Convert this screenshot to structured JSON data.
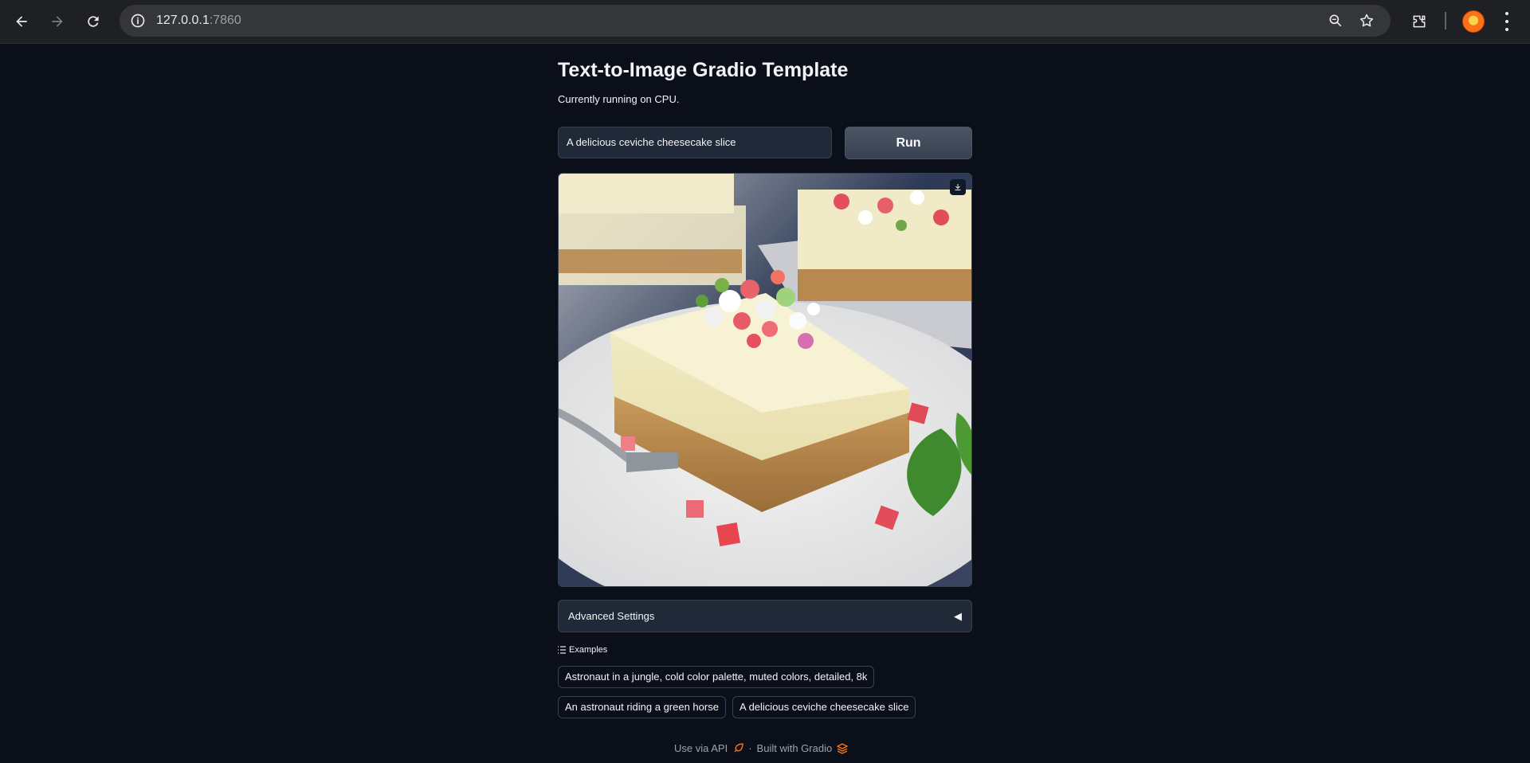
{
  "browser": {
    "url_host": "127.0.0.1",
    "url_port": ":7860"
  },
  "app": {
    "title": "Text-to-Image Gradio Template",
    "subtitle": "Currently running on CPU.",
    "prompt_value": "A delicious ceviche cheesecake slice",
    "run_label": "Run",
    "advanced_label": "Advanced Settings",
    "advanced_toggle": "◀",
    "examples_label": "Examples",
    "examples": [
      "Astronaut in a jungle, cold color palette, muted colors, detailed, 8k",
      "An astronaut riding a green horse",
      "A delicious ceviche cheesecake slice"
    ],
    "footer": {
      "api_label": "Use via API",
      "separator": "·",
      "built_label": "Built with Gradio"
    }
  },
  "colors": {
    "background": "#0b0f19",
    "panel": "#1f2937",
    "border": "#374151",
    "accent": "#f97316"
  }
}
